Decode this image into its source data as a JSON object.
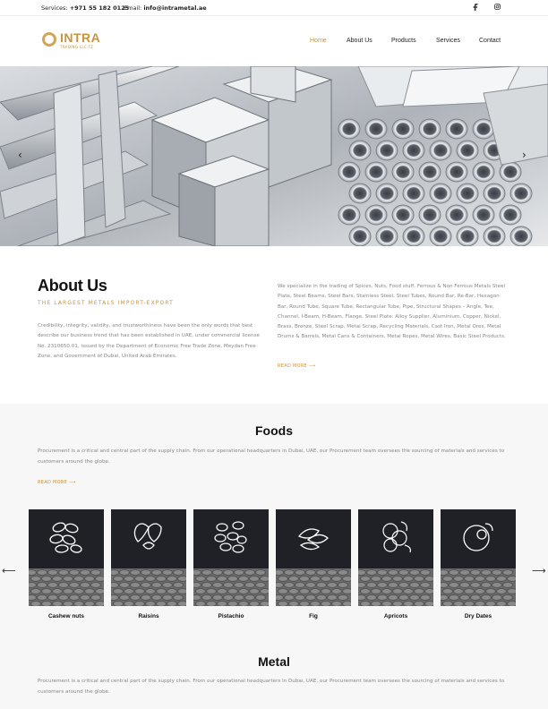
{
  "topbar": {
    "phone_label": "Services:",
    "phone_value": "+971 55 182 0125",
    "email_label": "Email:",
    "email_value": "info@intrametal.ae",
    "social": [
      "facebook-icon",
      "instagram-icon"
    ]
  },
  "brand": {
    "name": "INTRA",
    "subtitle": "TRADING LLC FZ",
    "accent": "#c89440"
  },
  "nav": {
    "items": [
      "Home",
      "About Us",
      "Products",
      "Services",
      "Contact"
    ],
    "active": "Home"
  },
  "hero": {
    "prev_label": "‹",
    "next_label": "›"
  },
  "about": {
    "title": "About Us",
    "subtitle": "THE LARGEST METALS IMPORT-EXPORT",
    "left_text": "Credibility, integrity, validity, and trustworthiness have been the only words that best describe our business trend that has been established in UAE, under commercial license No. 2310650.01, issued by the Department of Economic Free Trade Zone, Meydan Free Zone, and Government of Dubai, United Arab Emirates.",
    "right_text": "We specialize in the trading of Spices, Nuts, Food stuff, Ferrous & Non Ferrous Metals Steel Plate, Steel Beams, Steel Bars, Stainless Steel, Steel Tubes, Round Bar, Re-Bar, Hexagon Bar, Round Tube, Square Tube, Rectangular Tube, Pipe, Structural Shapes – Angle, Tee, Channel, I-Beam, H-Beam, Flange, Steel Plate. Alloy Supplier, Aluminium, Copper, Nickel, Brass, Bronze, Steel Scrap, Metal Scrap, Recycling Materials, Cast Iron, Metal Ores, Metal Drums & Barrels, Metal Cans & Containers, Metal Ropes, Metal Wires, Basic Steel Products.",
    "read_more": "READ MORE ⟶"
  },
  "foods": {
    "title": "Foods",
    "description": "Procurement is a critical and central part of the supply chain. From our operational headquarters in Dubai, UAE, our Procurement team oversees the sourcing of materials and services to customers around the globe.",
    "read_more": "READ MORE ⟶",
    "items": [
      {
        "label": "Cashew nuts",
        "icon": "cashew-icon"
      },
      {
        "label": "Raisins",
        "icon": "raisins-icon"
      },
      {
        "label": "Pistachio",
        "icon": "pistachio-icon"
      },
      {
        "label": "Fig",
        "icon": "fig-icon"
      },
      {
        "label": "Apricots",
        "icon": "apricots-icon"
      },
      {
        "label": "Dry Dates",
        "icon": "dates-icon"
      }
    ],
    "prev_label": "⟵",
    "next_label": "⟶"
  },
  "metal": {
    "title": "Metal",
    "description": "Procurement is a critical and central part of the supply chain. From our operational headquarters in Dubai, UAE, our Procurement team oversees the sourcing of materials and services to customers around the globe."
  }
}
